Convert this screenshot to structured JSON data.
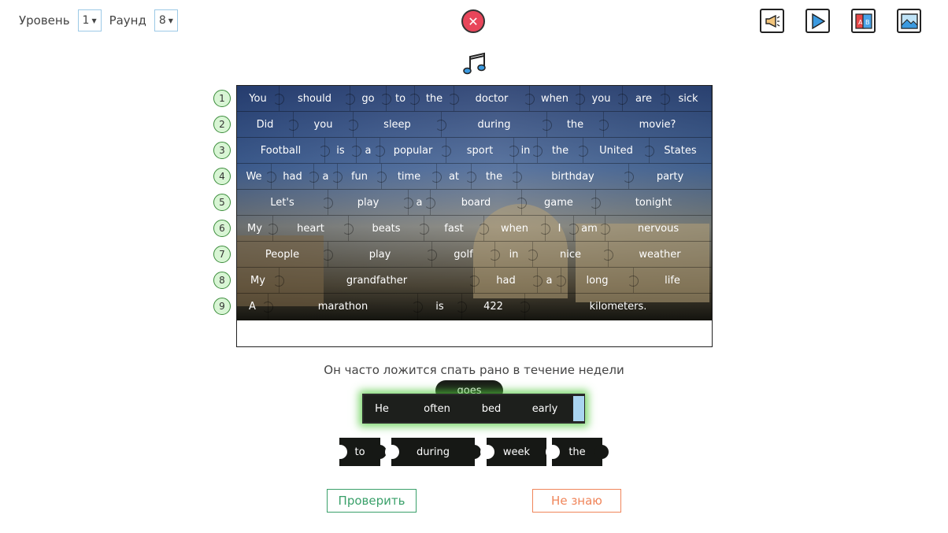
{
  "header": {
    "level_label": "Уровень",
    "level_value": "1",
    "round_label": "Раунд",
    "round_value": "8"
  },
  "tools": [
    {
      "icon": "megaphone-icon"
    },
    {
      "icon": "play-icon"
    },
    {
      "icon": "translate-icon"
    },
    {
      "icon": "image-icon"
    }
  ],
  "rows": [
    {
      "num": "1",
      "words": [
        "You",
        "should",
        "go",
        "to",
        "the",
        "doctor",
        "when",
        "you",
        "are",
        "sick"
      ]
    },
    {
      "num": "2",
      "words": [
        "Did",
        "you",
        "sleep",
        "during",
        "the",
        "movie?"
      ]
    },
    {
      "num": "3",
      "words": [
        "Football",
        "is",
        "a",
        "popular",
        "sport",
        "in",
        "the",
        "United",
        "States"
      ]
    },
    {
      "num": "4",
      "words": [
        "We",
        "had",
        "a",
        "fun",
        "time",
        "at",
        "the",
        "birthday",
        "party"
      ]
    },
    {
      "num": "5",
      "words": [
        "Let's",
        "play",
        "a",
        "board",
        "game",
        "tonight"
      ]
    },
    {
      "num": "6",
      "words": [
        "My",
        "heart",
        "beats",
        "fast",
        "when",
        "I",
        "am",
        "nervous"
      ]
    },
    {
      "num": "7",
      "words": [
        "People",
        "play",
        "golf",
        "in",
        "nice",
        "weather"
      ]
    },
    {
      "num": "8",
      "words": [
        "My",
        "grandfather",
        "had",
        "a",
        "long",
        "life"
      ]
    },
    {
      "num": "9",
      "words": [
        "A",
        "marathon",
        "is",
        "422",
        "kilometers."
      ]
    }
  ],
  "hint": "Он часто ложится спать рано в течение недели",
  "answer_words": [
    "He",
    "often",
    "bed",
    "early"
  ],
  "floating_word": "goes",
  "pieces": [
    "to",
    "during",
    "week",
    "the"
  ],
  "buttons": {
    "check": "Проверить",
    "dont_know": "Не знаю"
  },
  "colors": {
    "close": "#e8465a",
    "check": "#3aa06a",
    "dont_know": "#f0855a",
    "number_badge": "#d8f5d4"
  }
}
